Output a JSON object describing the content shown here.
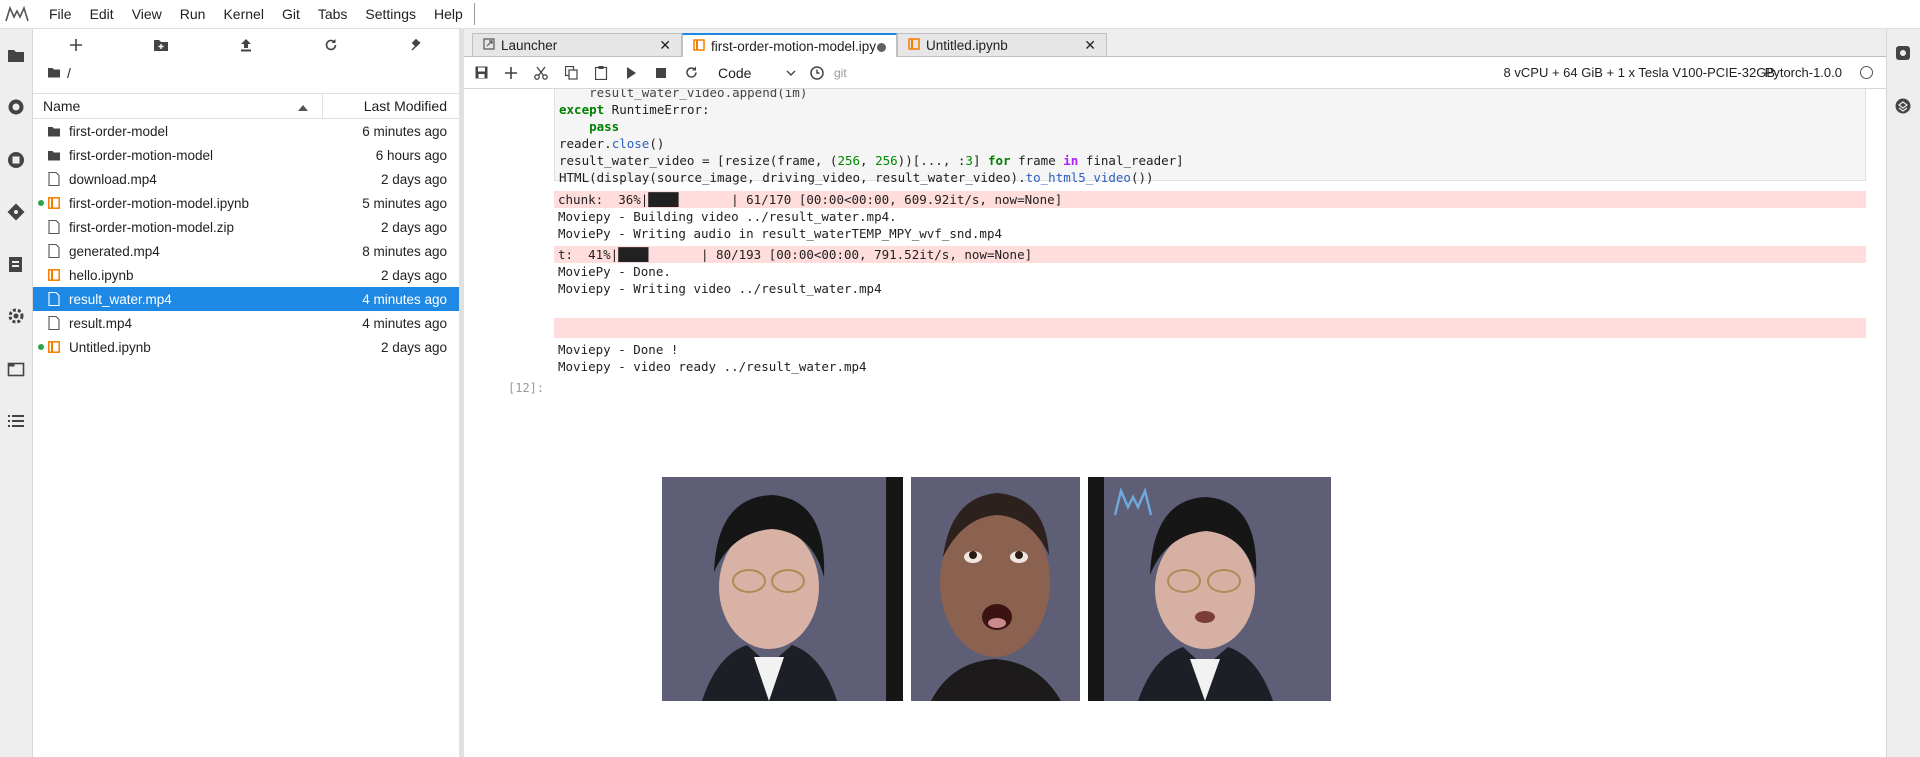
{
  "menubar": {
    "items": [
      "File",
      "Edit",
      "View",
      "Run",
      "Kernel",
      "Git",
      "Tabs",
      "Settings",
      "Help"
    ]
  },
  "filebrowser": {
    "path": "/",
    "col_name": "Name",
    "col_modified": "Last Modified",
    "files": [
      {
        "name": "first-order-model",
        "modified": "6 minutes ago",
        "icon": "folder-icon",
        "running": false,
        "selected": false
      },
      {
        "name": "first-order-motion-model",
        "modified": "6 hours ago",
        "icon": "folder-icon",
        "running": false,
        "selected": false
      },
      {
        "name": "download.mp4",
        "modified": "2 days ago",
        "icon": "file-icon",
        "running": false,
        "selected": false
      },
      {
        "name": "first-order-motion-model.ipynb",
        "modified": "5 minutes ago",
        "icon": "notebook-icon",
        "running": true,
        "selected": false
      },
      {
        "name": "first-order-motion-model.zip",
        "modified": "2 days ago",
        "icon": "file-icon",
        "running": false,
        "selected": false
      },
      {
        "name": "generated.mp4",
        "modified": "8 minutes ago",
        "icon": "file-icon",
        "running": false,
        "selected": false
      },
      {
        "name": "hello.ipynb",
        "modified": "2 days ago",
        "icon": "notebook-icon",
        "running": false,
        "selected": false
      },
      {
        "name": "result_water.mp4",
        "modified": "4 minutes ago",
        "icon": "file-icon",
        "running": false,
        "selected": true
      },
      {
        "name": "result.mp4",
        "modified": "4 minutes ago",
        "icon": "file-icon",
        "running": false,
        "selected": false
      },
      {
        "name": "Untitled.ipynb",
        "modified": "2 days ago",
        "icon": "notebook-icon",
        "running": true,
        "selected": false
      }
    ]
  },
  "tabs": [
    {
      "label": "Launcher",
      "icon": "launcher-icon"
    },
    {
      "label": "first-order-motion-model.ipynb",
      "icon": "notebook-icon"
    },
    {
      "label": "Untitled.ipynb",
      "icon": "notebook-icon"
    }
  ],
  "toolbar": {
    "cell_type": "Code",
    "git_label": "git",
    "kernel_info": "8 vCPU + 64 GiB + 1 x Tesla V100-PCIE-32GB",
    "kernel_name": "Pytorch-1.0.0"
  },
  "outputs": {
    "chunk_progress": "chunk:  36%|████       | 61/170 [00:00<00:00, 609.92it/s, now=None]",
    "building": "Moviepy - Building video ../result_water.mp4.",
    "writing_audio": "MoviePy - Writing audio in result_waterTEMP_MPY_wvf_snd.mp4",
    "t_progress": "t:  41%|████       | 80/193 [00:00<00:00, 791.52it/s, now=None]",
    "moviepy_done": "MoviePy - Done.",
    "writing_video": "Moviepy - Writing video ../result_water.mp4",
    "done_bang": "Moviepy - Done !",
    "video_ready": "Moviepy - video ready ../result_water.mp4",
    "prompt": "[12]:"
  },
  "colors": {
    "accent": "#1e88e5",
    "running_dot": "#2ea44f",
    "stderr_bg": "#ffdddd",
    "notebook_icon": "#f57c00"
  }
}
